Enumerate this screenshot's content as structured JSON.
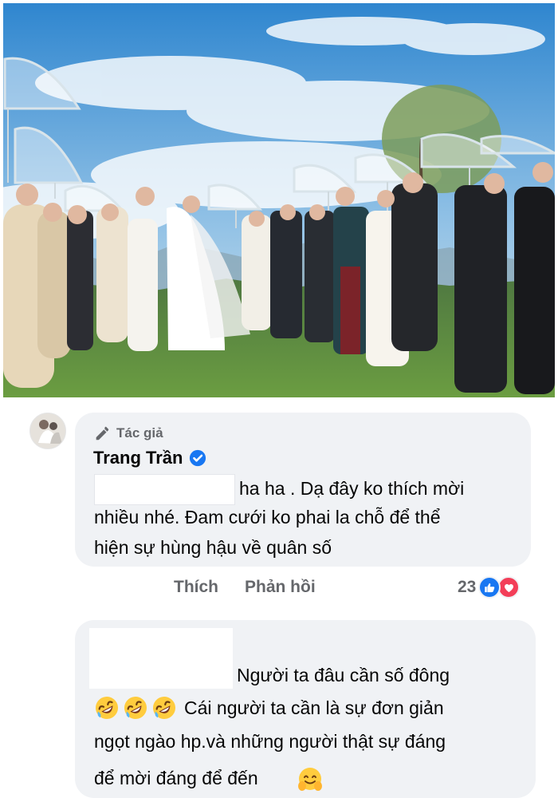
{
  "comment_1": {
    "author_tag": "Tác giả",
    "author_name": "Trang Trần",
    "text_line_1": "ha ha . Dạ đây ko thích mời",
    "text_line_2": "nhiều nhé. Đam cưới ko phai la chỗ để thể",
    "text_line_3": "hiện sự hùng hậu về quân số",
    "actions": {
      "like": "Thích",
      "reply": "Phản hồi"
    },
    "reaction_count": "23",
    "icons": {
      "author": "pencil-icon",
      "verified": "verified-badge-icon",
      "like": "like-icon",
      "love": "love-icon"
    }
  },
  "comment_2": {
    "text_line_1": "Người ta đâu cần số đông",
    "text_line_2": "Cái người ta cần là sự đơn giản",
    "text_line_3": "ngọt ngào hp.và những người thật sự đáng",
    "text_line_4": "để mời đáng để đến",
    "emoji": {
      "laugh": "rolling-on-floor-laughing-emoji",
      "hug": "hugging-face-emoji"
    }
  },
  "colors": {
    "bubble": "#f0f2f5",
    "secondary_text": "#65676b",
    "facebook_blue": "#1877f2",
    "love_red": "#f33e58"
  }
}
